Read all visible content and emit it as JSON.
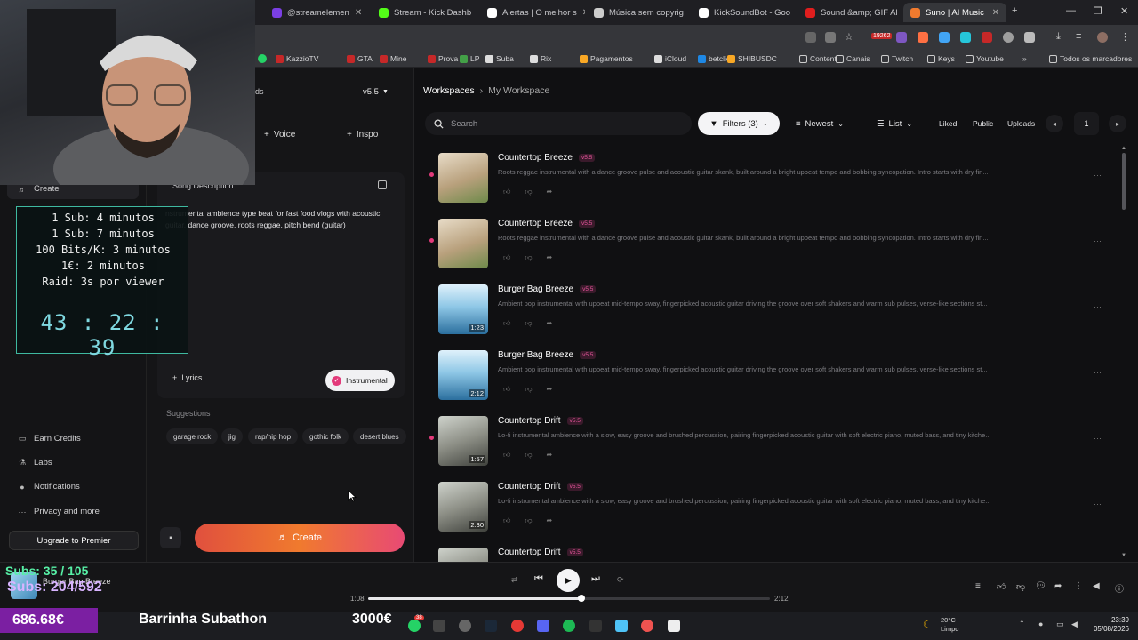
{
  "browser": {
    "tabs": [
      {
        "label": "@streamelemen",
        "color": "#7b3fe4"
      },
      {
        "label": "Stream - Kick Dashb",
        "color": "#53fc18"
      },
      {
        "label": "Alertas | O melhor s",
        "color": "#ffffff"
      },
      {
        "label": "Música sem copyrig",
        "color": "#cccccc"
      },
      {
        "label": "KickSoundBot - Goo",
        "color": "#ffffff"
      },
      {
        "label": "Sound &amp; GIF Al",
        "color": "#e01e1e"
      },
      {
        "label": "Suno | AI Music",
        "color": "#f07a2e"
      }
    ],
    "bookmarks": [
      "KazzioTV",
      "GTA",
      "Mine",
      "Prova",
      "LP",
      "Suba",
      "Rix",
      "Pagamentos",
      "iCloud",
      "betclic",
      "SHIBUSDC",
      "Content",
      "Canais",
      "Twitch",
      "Keys",
      "Youtube"
    ],
    "bookmarks_more": "»",
    "all_bookmarks": "Todos os marcadores",
    "badge_count": "19262"
  },
  "sidebar": {
    "create_label": "Create",
    "items": [
      {
        "icon": "earn-credits-icon",
        "label": "Earn Credits"
      },
      {
        "icon": "labs-icon",
        "label": "Labs"
      },
      {
        "icon": "bell-icon",
        "label": "Notifications"
      },
      {
        "icon": "more-dots-icon",
        "label": "Privacy and more"
      }
    ],
    "upgrade_label": "Upgrade to Premier"
  },
  "composer": {
    "tab_partial": "ds",
    "version": "v5.5",
    "voice_label": "Voice",
    "inspo_label": "Inspo",
    "desc_label": "Song Description",
    "desc_text": "nstrumental ambience type beat for fast food vlogs with acoustic guitar, dance groove, roots reggae, pitch bend (guitar)",
    "lyrics_label": "Lyrics",
    "instrumental_label": "Instrumental",
    "suggestions_title": "Suggestions",
    "suggestions": [
      "garage rock",
      "jig",
      "rap/hip hop",
      "gothic folk",
      "desert blues"
    ],
    "create_label": "Create"
  },
  "workspace": {
    "crumb_root": "Workspaces",
    "crumb_sep": "›",
    "crumb_current": "My Workspace",
    "search_placeholder": "Search",
    "filters_label": "Filters (3)",
    "sort_label": "Newest",
    "view_label": "List",
    "liked_label": "Liked",
    "public_label": "Public",
    "uploads_label": "Uploads",
    "page": "1",
    "songs": [
      {
        "title": "Countertop Breeze",
        "version": "v5.5",
        "desc": "Roots reggae instrumental with a dance groove pulse and acoustic guitar skank, built around a bright upbeat tempo and bobbing syncopation. Intro starts with dry fin...",
        "duration": "",
        "marked": true,
        "thumb": "plant"
      },
      {
        "title": "Countertop Breeze",
        "version": "v5.5",
        "desc": "Roots reggae instrumental with a dance groove pulse and acoustic guitar skank, built around a bright upbeat tempo and bobbing syncopation. Intro starts with dry fin...",
        "duration": "",
        "marked": true,
        "thumb": "plant"
      },
      {
        "title": "Burger Bag Breeze",
        "version": "v5.5",
        "desc": "Ambient pop instrumental with upbeat mid-tempo sway, fingerpicked acoustic guitar driving the groove over soft shakers and warm sub pulses, verse-like sections st...",
        "duration": "1:23",
        "marked": false,
        "thumb": "ice"
      },
      {
        "title": "Burger Bag Breeze",
        "version": "v5.5",
        "desc": "Ambient pop instrumental with upbeat mid-tempo sway, fingerpicked acoustic guitar driving the groove over soft shakers and warm sub pulses, verse-like sections st...",
        "duration": "2:12",
        "marked": false,
        "thumb": "ice"
      },
      {
        "title": "Countertop Drift",
        "version": "v5.5",
        "desc": "Lo-fi instrumental ambience with a slow, easy groove and brushed percussion, pairing fingerpicked acoustic guitar with soft electric piano, muted bass, and tiny kitche...",
        "duration": "1:57",
        "marked": true,
        "thumb": "kitchen"
      },
      {
        "title": "Countertop Drift",
        "version": "v5.5",
        "desc": "Lo-fi instrumental ambience with a slow, easy groove and brushed percussion, pairing fingerpicked acoustic guitar with soft electric piano, muted bass, and tiny kitche...",
        "duration": "2:30",
        "marked": false,
        "thumb": "kitchen"
      },
      {
        "title": "Countertop Drift",
        "version": "v5.5",
        "desc": "",
        "duration": "",
        "marked": false,
        "thumb": "kitchen"
      }
    ]
  },
  "overlay": {
    "timer_lines": [
      "1 Sub: 4 minutos",
      "1 Sub: 7 minutos",
      "100 Bits/K: 3 minutos",
      "1€: 2 minutos",
      "Raid: 3s por viewer"
    ],
    "timer_clock": "43 : 22 : 39",
    "subs_top": "Subs: 35 / 105",
    "subs_bottom": "Subs: 204/592",
    "money": "686.68€",
    "bar_label": "Barrinha Subathon",
    "goal": "3000€"
  },
  "player": {
    "now_playing": "Burger Bag Breeze",
    "current_time": "1:08",
    "total_time": "2:12",
    "progress": 0.53
  },
  "taskbar": {
    "weather_temp": "20°C",
    "weather_desc": "Limpo",
    "time": "23:39",
    "date": "05/08/2026",
    "badge": "38"
  },
  "colors": {
    "accent": "#e33a7a",
    "create_gradient_start": "#e0503e",
    "create_gradient_end": "#e84a74"
  }
}
